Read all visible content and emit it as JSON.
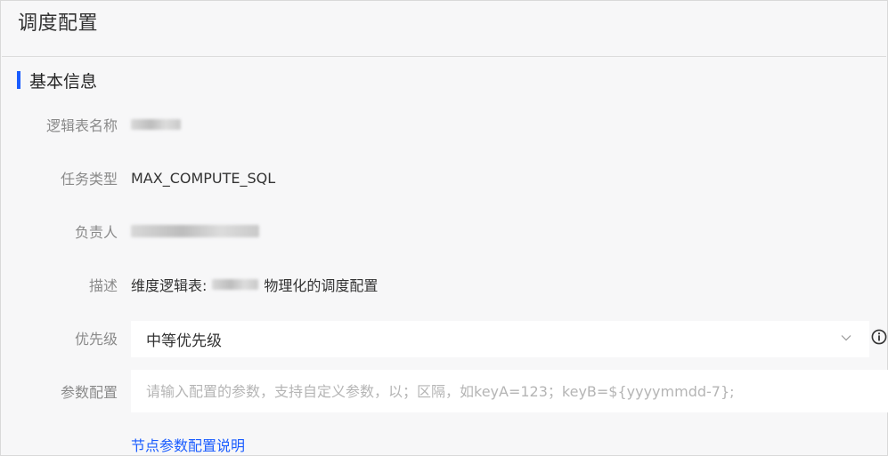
{
  "header": {
    "title": "调度配置"
  },
  "section": {
    "title": "基本信息"
  },
  "fields": {
    "logical_table_name": {
      "label": "逻辑表名称"
    },
    "task_type": {
      "label": "任务类型",
      "value": "MAX_COMPUTE_SQL"
    },
    "owner": {
      "label": "负责人"
    },
    "description": {
      "label": "描述",
      "prefix": "维度逻辑表:",
      "suffix": "物理化的调度配置"
    },
    "priority": {
      "label": "优先级",
      "value": "中等优先级"
    },
    "params": {
      "label": "参数配置",
      "placeholder": "请输入配置的参数，支持自定义参数，以；区隔，如keyA=123；keyB=${yyyymmdd-7};"
    }
  },
  "help_link": "节点参数配置说明",
  "icons": {
    "dropdown": "chevron-down-icon",
    "info": "info-circle-icon"
  },
  "colors": {
    "accent": "#1a5cff",
    "label": "#8a8a8a",
    "text": "#333333"
  }
}
